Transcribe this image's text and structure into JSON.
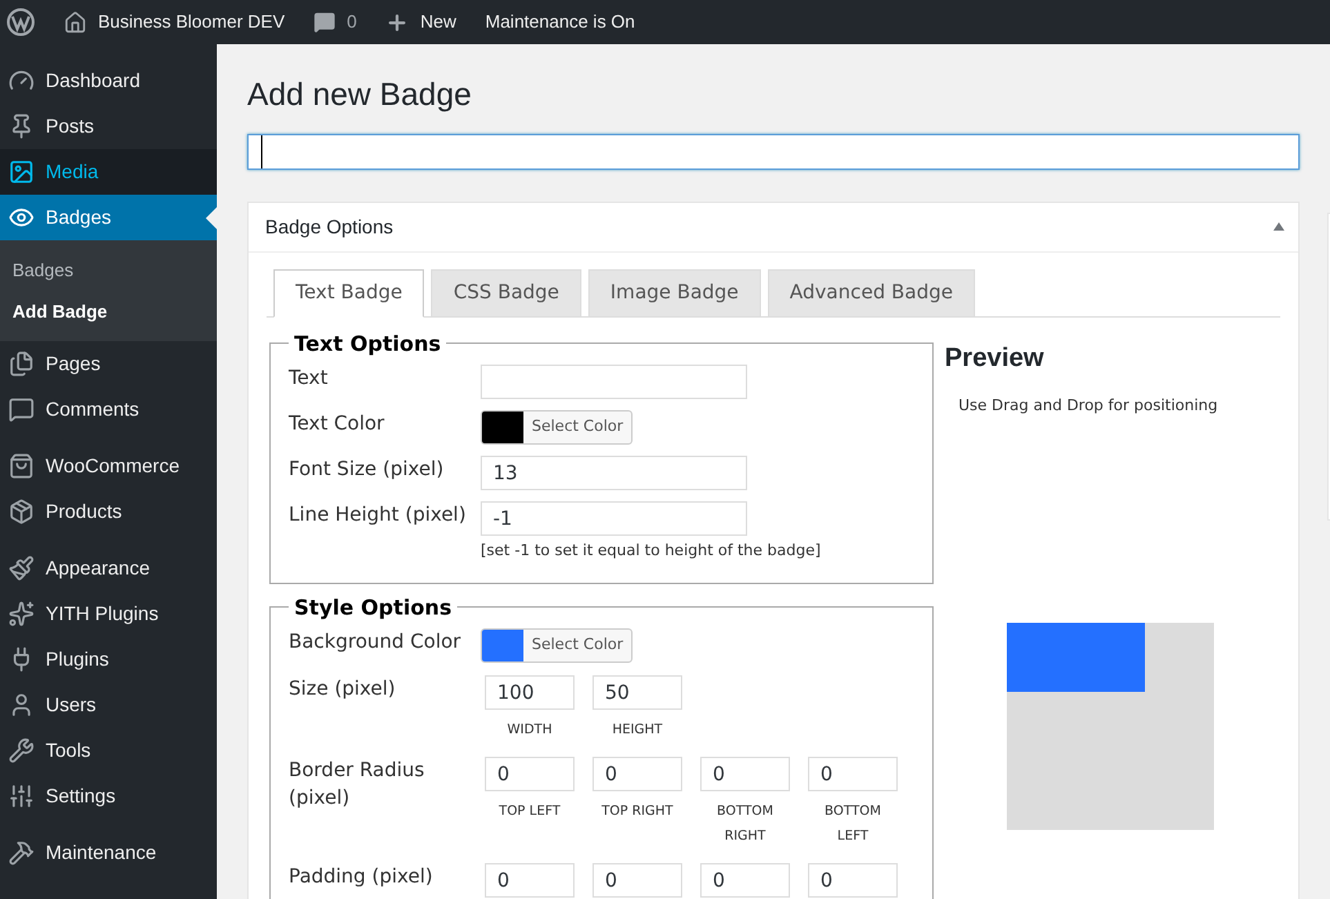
{
  "admin_bar": {
    "items": [
      {
        "kind": "site",
        "label": "Business Bloomer DEV"
      },
      {
        "kind": "comments",
        "label": "0"
      },
      {
        "kind": "new",
        "label": "New"
      },
      {
        "kind": "text",
        "label": "Maintenance is On"
      }
    ]
  },
  "sidebar": {
    "groups": [
      {
        "items": [
          {
            "label": "Dashboard",
            "selected": false,
            "highlighted": false
          },
          {
            "label": "Posts",
            "selected": false,
            "highlighted": false
          },
          {
            "label": "Media",
            "selected": false,
            "highlighted": true
          },
          {
            "label": "Badges",
            "selected": true,
            "children": [
              {
                "label": "Badges",
                "selected": false
              },
              {
                "label": "Add Badge",
                "selected": true
              }
            ]
          },
          {
            "label": "Pages",
            "selected": false,
            "highlighted": false
          },
          {
            "label": "Comments",
            "selected": false,
            "highlighted": false
          }
        ]
      },
      {
        "items": [
          {
            "label": "WooCommerce",
            "selected": false,
            "highlighted": false
          },
          {
            "label": "Products",
            "selected": false,
            "highlighted": false
          }
        ]
      },
      {
        "items": [
          {
            "label": "Appearance",
            "selected": false,
            "highlighted": false
          },
          {
            "label": "YITH Plugins",
            "selected": false,
            "highlighted": false
          },
          {
            "label": "Plugins",
            "selected": false,
            "highlighted": false
          },
          {
            "label": "Users",
            "selected": false,
            "highlighted": false
          },
          {
            "label": "Tools",
            "selected": false,
            "highlighted": false
          },
          {
            "label": "Settings",
            "selected": false,
            "highlighted": false
          }
        ]
      },
      {
        "items": [
          {
            "label": "Maintenance",
            "selected": false,
            "highlighted": false
          }
        ]
      }
    ]
  },
  "page": {
    "title": "Add new Badge",
    "postbox": {
      "title": "Badge Options",
      "expanded": true,
      "tabs": [
        {
          "label": "Text Badge",
          "selected": true
        },
        {
          "label": "CSS Badge",
          "selected": false
        },
        {
          "label": "Image Badge",
          "selected": false
        },
        {
          "label": "Advanced Badge",
          "selected": false
        }
      ],
      "text_options": {
        "legend": "Text Options",
        "rows": [
          {
            "kind": "text",
            "label": "Text"
          },
          {
            "kind": "color",
            "label": "Text Color",
            "color": "#000000",
            "button": "Select Color"
          },
          {
            "kind": "text",
            "label": "Font Size (pixel)",
            "value": "13"
          },
          {
            "kind": "text",
            "label": "Line Height (pixel)",
            "value": "-1",
            "hint": "[set -1 to set it equal to height of the badge]"
          }
        ]
      },
      "style_options": {
        "legend": "Style Options",
        "rows": [
          {
            "kind": "color",
            "label": "Background Color",
            "color": "#2470ff",
            "button": "Select Color"
          },
          {
            "kind": "multi",
            "label": "Size (pixel)",
            "inputs": [
              {
                "value": "100",
                "caption": "WIDTH"
              },
              {
                "value": "50",
                "caption": "HEIGHT"
              }
            ]
          },
          {
            "kind": "multi",
            "label": "Border Radius (pixel)",
            "inputs": [
              {
                "value": "0",
                "caption": "TOP LEFT"
              },
              {
                "value": "0",
                "caption": "TOP RIGHT"
              },
              {
                "value": "0",
                "caption": "BOTTOM RIGHT"
              },
              {
                "value": "0",
                "caption": "BOTTOM LEFT"
              }
            ]
          },
          {
            "kind": "multi",
            "label": "Padding (pixel)",
            "inputs": [
              {
                "value": "0"
              },
              {
                "value": "0"
              },
              {
                "value": "0"
              },
              {
                "value": "0"
              }
            ]
          }
        ]
      },
      "preview": {
        "title": "Preview",
        "note": "Use Drag and Drop for positioning"
      }
    }
  }
}
